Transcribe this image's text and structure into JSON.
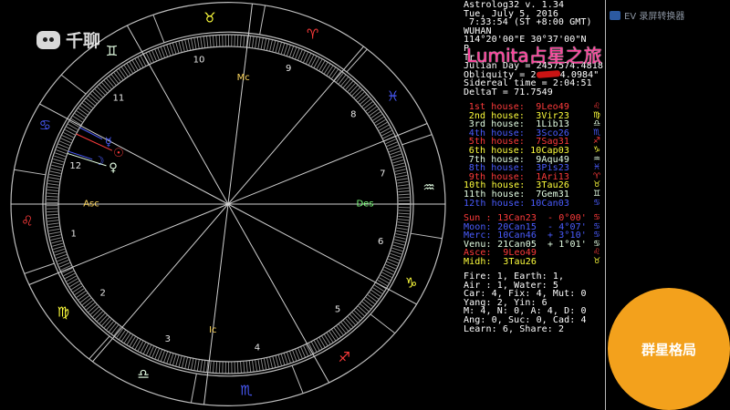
{
  "watermark": {
    "logo_text": "千聊",
    "recorder_text": "EV 录屏转换器",
    "overlay_title": "Lumita占星之旅"
  },
  "badge": {
    "label": "群星格局",
    "color": "#f3a11c"
  },
  "info": {
    "program": "Astrolog32 v. 1.34",
    "date": "Tue, July 5, 2016",
    "time": "7:33:54 (ST +8:00 GMT)",
    "location": "WUHAN",
    "coordinates": "114°20'00\"E 30°37'00\"N",
    "house_system_partial": "P",
    "zodiac_partial": "Tr",
    "julian_day": "Julian Day = 2457574.4818",
    "obliquity_start": "Obliquity = 2",
    "obliquity_end": "4.0984\"",
    "sidereal_time": "Sidereal time = 2:04:51",
    "delta_t": "DeltaT = 71.7549"
  },
  "colors": {
    "lines": "#cfcfcf",
    "ring": "#bdbdbd",
    "ticks": "#8f8f8f",
    "house_numbers": "#e8e8e8"
  },
  "houses": [
    {
      "label": "1st house:",
      "cusp": "9Leo49",
      "glyph": "♌",
      "color": "#ff3b3b"
    },
    {
      "label": "2nd house:",
      "cusp": "3Vir23",
      "glyph": "♍",
      "color": "#ffff3c"
    },
    {
      "label": "3rd house:",
      "cusp": "1Lib13",
      "glyph": "♎",
      "color": "#e4ffe4"
    },
    {
      "label": "4th house:",
      "cusp": "3Sco26",
      "glyph": "♏",
      "color": "#4a5cff"
    },
    {
      "label": "5th house:",
      "cusp": "7Sag31",
      "glyph": "♐",
      "color": "#ff3b3b"
    },
    {
      "label": "6th house:",
      "cusp": "10Cap03",
      "glyph": "♑",
      "color": "#ffff3c"
    },
    {
      "label": "7th house:",
      "cusp": "9Aqu49",
      "glyph": "♒",
      "color": "#e4ffe4"
    },
    {
      "label": "8th house:",
      "cusp": "3Pis23",
      "glyph": "♓",
      "color": "#4a5cff"
    },
    {
      "label": "9th house:",
      "cusp": "1Ari13",
      "glyph": "♈",
      "color": "#ff3b3b"
    },
    {
      "label": "10th house:",
      "cusp": "3Tau26",
      "glyph": "♉",
      "color": "#ffff3c"
    },
    {
      "label": "11th house:",
      "cusp": "7Gem31",
      "glyph": "♊",
      "color": "#e4ffe4"
    },
    {
      "label": "12th house:",
      "cusp": "10Can03",
      "glyph": "♋",
      "color": "#4a5cff"
    }
  ],
  "planets": [
    {
      "label": "Sun :",
      "position": "13Can23",
      "latitude": "- 0°00'",
      "glyph": "☉",
      "sign_glyph": "♋",
      "color": "#ff3b3b"
    },
    {
      "label": "Moon:",
      "position": "20Can15",
      "latitude": "- 4°07'",
      "glyph": "☽",
      "sign_glyph": "♋",
      "color": "#4a5cff"
    },
    {
      "label": "Merc:",
      "position": "10Can46",
      "latitude": "+ 3°10'",
      "glyph": "☿",
      "sign_glyph": "♋",
      "color": "#4a5cff"
    },
    {
      "label": "Venu:",
      "position": "21Can05",
      "latitude": "+ 1°01'",
      "glyph": "♀",
      "sign_glyph": "♋",
      "color": "#e4ffe4"
    },
    {
      "label": "Asce:",
      "position": "9Leo49",
      "sign_glyph": "♌",
      "color": "#ff3b3b"
    },
    {
      "label": "Midh:",
      "position": "3Tau26",
      "sign_glyph": "♉",
      "color": "#ffff3c"
    }
  ],
  "summary": [
    "Fire: 1, Earth: 1,",
    "Air : 1, Water: 5",
    "Car: 4, Fix: 4, Mut: 0",
    "Yang: 2, Yin: 6",
    "M: 4, N: 0, A: 4, D: 0",
    "Ang: 0, Suc: 0, Cad: 4",
    "Learn: 6, Share: 2"
  ],
  "wheel": {
    "signs": [
      {
        "glyph": "♈",
        "color": "#ff3b3b"
      },
      {
        "glyph": "♉",
        "color": "#ffff3c"
      },
      {
        "glyph": "♊",
        "color": "#e4ffe4"
      },
      {
        "glyph": "♋",
        "color": "#4a5cff"
      },
      {
        "glyph": "♌",
        "color": "#ff3b3b"
      },
      {
        "glyph": "♍",
        "color": "#ffff3c"
      },
      {
        "glyph": "♎",
        "color": "#e4ffe4"
      },
      {
        "glyph": "♏",
        "color": "#4a5cff"
      },
      {
        "glyph": "♐",
        "color": "#ff3b3b"
      },
      {
        "glyph": "♑",
        "color": "#ffff3c"
      },
      {
        "glyph": "♒",
        "color": "#e4ffe4"
      },
      {
        "glyph": "♓",
        "color": "#4a5cff"
      }
    ],
    "house_numbers": [
      "1",
      "2",
      "3",
      "4",
      "5",
      "6",
      "7",
      "8",
      "9",
      "10",
      "11",
      "12"
    ],
    "angles": [
      {
        "label": "Asc",
        "color": "#ffd860"
      },
      {
        "label": "Mc",
        "color": "#ffd860"
      },
      {
        "label": "Des",
        "color": "#7cff7c"
      },
      {
        "label": "Ic",
        "color": "#ffd860"
      }
    ]
  }
}
